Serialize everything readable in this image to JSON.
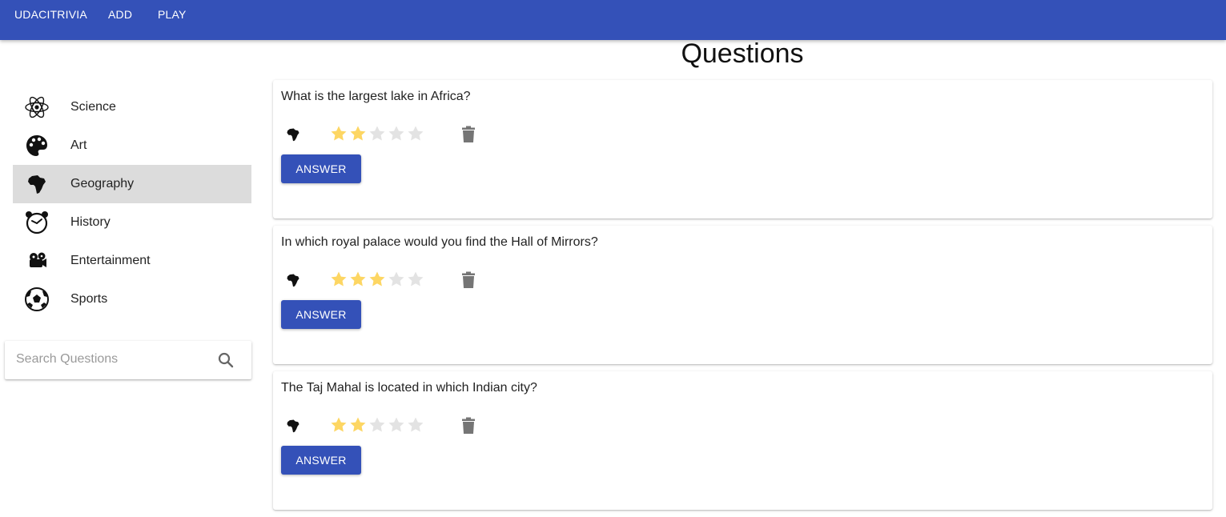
{
  "appbar": {
    "color": "#3451b8",
    "items": [
      {
        "label": "UDACITRIVIA"
      },
      {
        "label": "ADD"
      },
      {
        "label": "PLAY"
      }
    ]
  },
  "page": {
    "title": "Questions"
  },
  "sidebar": {
    "selected": "Geography",
    "categories": [
      {
        "label": "Science",
        "icon": "atom-icon"
      },
      {
        "label": "Art",
        "icon": "palette-icon"
      },
      {
        "label": "Geography",
        "icon": "africa-icon"
      },
      {
        "label": "History",
        "icon": "alarm-clock-icon"
      },
      {
        "label": "Entertainment",
        "icon": "film-camera-icon"
      },
      {
        "label": "Sports",
        "icon": "soccer-ball-icon"
      }
    ]
  },
  "search": {
    "placeholder": "Search Questions",
    "value": "",
    "icon": "search-icon"
  },
  "questions": [
    {
      "text": "What is the largest lake in Africa?",
      "category_icon": "africa-icon",
      "difficulty": 2,
      "max_difficulty": 5,
      "answer_label": "ANSWER",
      "delete_icon": "trash-icon"
    },
    {
      "text": "In which royal palace would you find the Hall of Mirrors?",
      "category_icon": "africa-icon",
      "difficulty": 3,
      "max_difficulty": 5,
      "answer_label": "ANSWER",
      "delete_icon": "trash-icon"
    },
    {
      "text": "The Taj Mahal is located in which Indian city?",
      "category_icon": "africa-icon",
      "difficulty": 2,
      "max_difficulty": 5,
      "answer_label": "ANSWER",
      "delete_icon": "trash-icon"
    }
  ],
  "colors": {
    "star_filled": "#fdd663",
    "star_empty": "#e3e3e3",
    "button": "#3451b8",
    "selected_bg": "#dcdcdc",
    "trash": "#757575"
  }
}
